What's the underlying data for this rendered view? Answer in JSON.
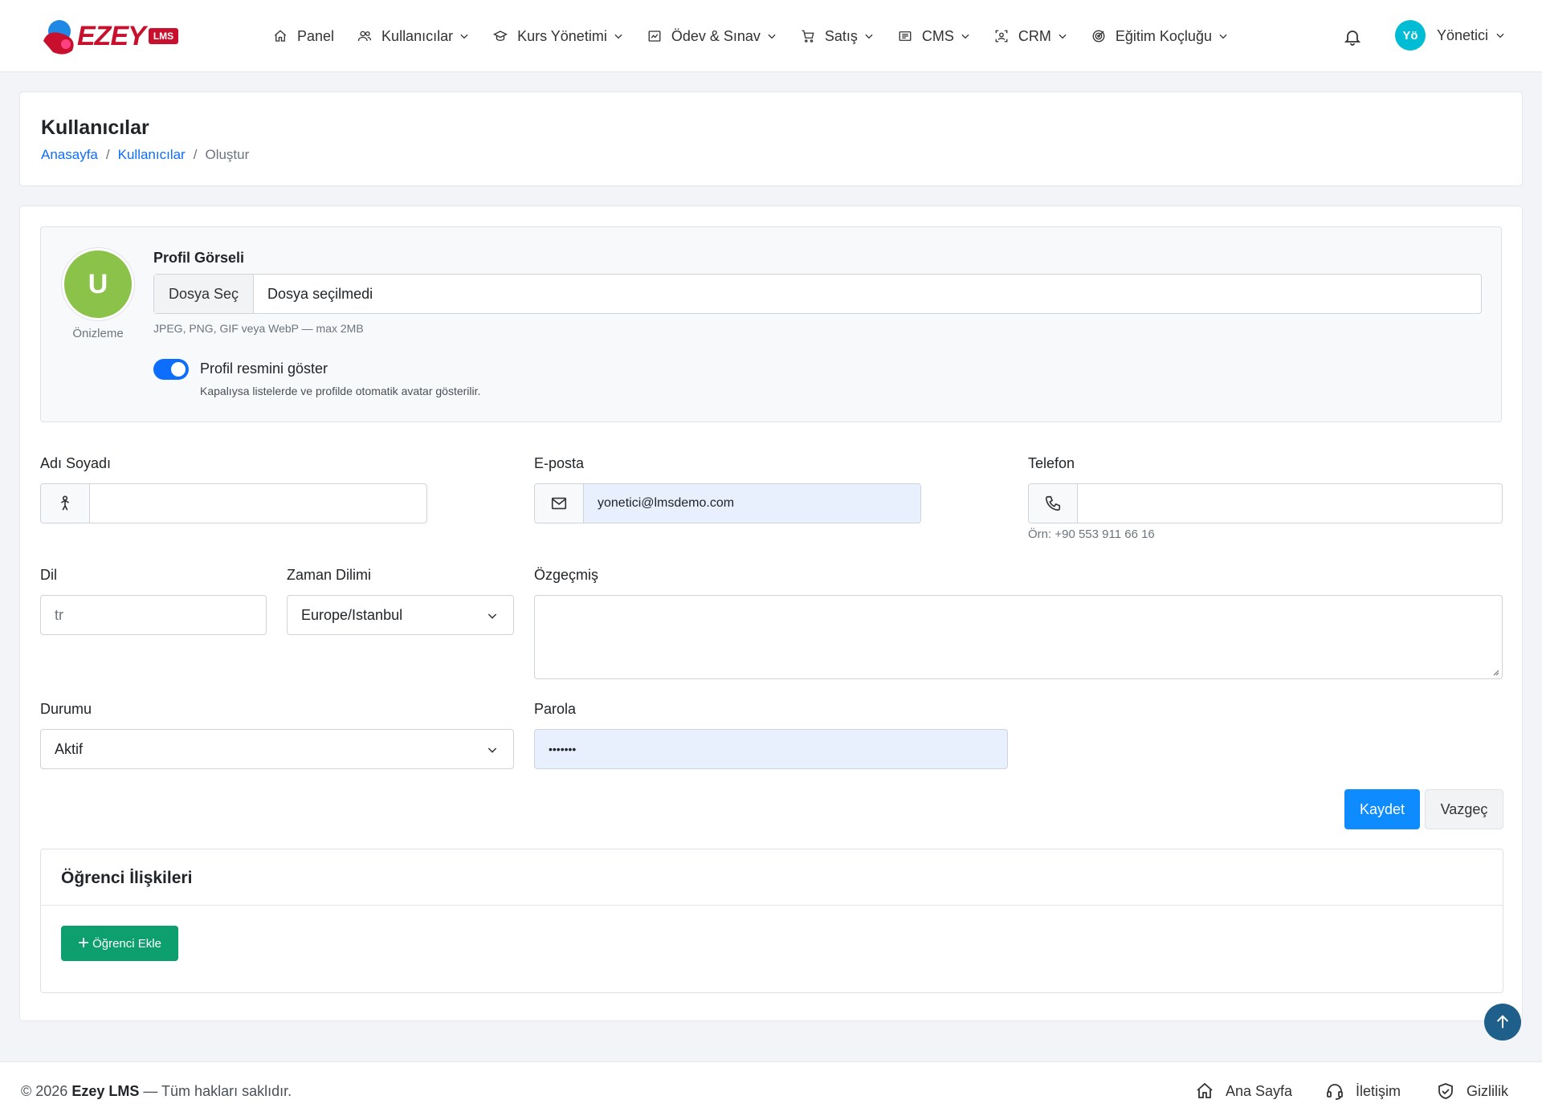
{
  "brand": {
    "name": "EZEY",
    "badge": "LMS"
  },
  "nav": {
    "items": [
      {
        "label": "Panel",
        "icon": "home-icon",
        "dropdown": false
      },
      {
        "label": "Kullanıcılar",
        "icon": "users-icon",
        "dropdown": true
      },
      {
        "label": "Kurs Yönetimi",
        "icon": "graduation-cap-icon",
        "dropdown": true
      },
      {
        "label": "Ödev & Sınav",
        "icon": "exam-icon",
        "dropdown": true
      },
      {
        "label": "Satış",
        "icon": "cart-icon",
        "dropdown": true
      },
      {
        "label": "CMS",
        "icon": "document-icon",
        "dropdown": true
      },
      {
        "label": "CRM",
        "icon": "scan-person-icon",
        "dropdown": true
      },
      {
        "label": "Eğitim Koçluğu",
        "icon": "target-icon",
        "dropdown": true
      }
    ],
    "user": {
      "initials": "Yö",
      "name": "Yönetici"
    }
  },
  "header": {
    "title": "Kullanıcılar",
    "breadcrumb": {
      "home": "Anasayfa",
      "section": "Kullanıcılar",
      "current": "Oluştur"
    }
  },
  "profile": {
    "avatar_letter": "U",
    "preview_label": "Önizleme",
    "title": "Profil Görseli",
    "file_button": "Dosya Seç",
    "file_status": "Dosya seçilmedi",
    "file_help": "JPEG, PNG, GIF veya WebP — max 2MB",
    "toggle_label": "Profil resmini göster",
    "toggle_help": "Kapalıysa listelerde ve profilde otomatik avatar gösterilir.",
    "toggle_on": true
  },
  "form": {
    "name": {
      "label": "Adı Soyadı",
      "value": ""
    },
    "email": {
      "label": "E-posta",
      "value": "yonetici@lmsdemo.com"
    },
    "phone": {
      "label": "Telefon",
      "value": "",
      "help": "Örn: +90 553 911 66 16"
    },
    "language": {
      "label": "Dil",
      "placeholder": "tr"
    },
    "timezone": {
      "label": "Zaman Dilimi",
      "value": "Europe/Istanbul"
    },
    "bio": {
      "label": "Özgeçmiş",
      "value": ""
    },
    "status": {
      "label": "Durumu",
      "value": "Aktif"
    },
    "password": {
      "label": "Parola",
      "value": "•••••••"
    },
    "save": "Kaydet",
    "cancel": "Vazgeç"
  },
  "relations": {
    "title": "Öğrenci İlişkileri",
    "add_button": "Öğrenci Ekle"
  },
  "footer": {
    "year": "© 2026",
    "brand": "Ezey LMS",
    "rights": "— Tüm hakları saklıdır.",
    "links": [
      "Ana Sayfa",
      "İletişim",
      "Gizlilik"
    ]
  },
  "colors": {
    "primary": "#0d8bff",
    "success": "#0e9f6e",
    "brand": "#c8102e",
    "avatar": "#8bc34a"
  }
}
